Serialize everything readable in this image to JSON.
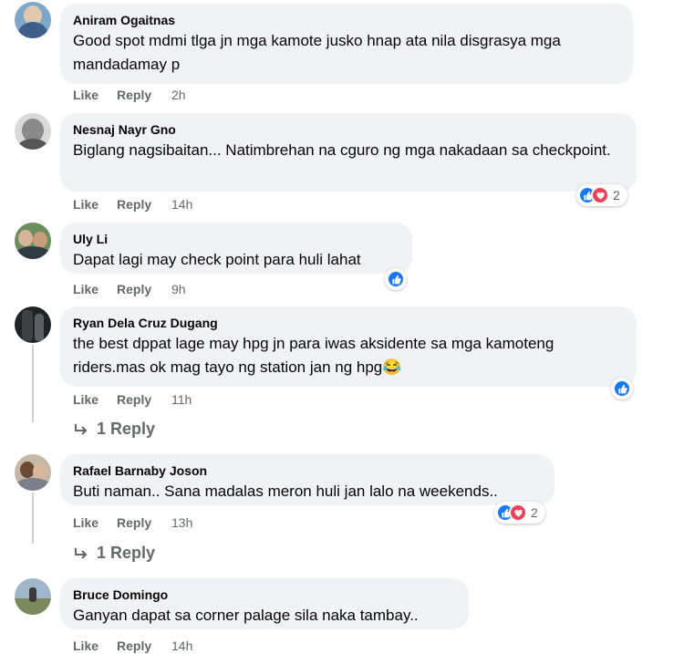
{
  "comments": [
    {
      "author": "Aniram Ogaitnas",
      "text": "Good spot mdmi tlga jn mga kamote jusko hnap ata nila disgrasya mga mandadamay p",
      "like": "Like",
      "reply": "Reply",
      "time": "2h"
    },
    {
      "author": "Nesnaj Nayr Gno",
      "text": "Biglang nagsibaitan... Natimbrehan na cguro ng mga nakadaan sa checkpoint.",
      "like": "Like",
      "reply": "Reply",
      "time": "14h",
      "reactions": "2"
    },
    {
      "author": "Uly Li",
      "text": "Dapat lagi may check point para huli lahat",
      "like": "Like",
      "reply": "Reply",
      "time": "9h"
    },
    {
      "author": "Ryan Dela Cruz Dugang",
      "text": "the best dppat lage may hpg jn para iwas aksidente sa mga kamoteng riders.mas ok mag tayo ng station jan ng hpg😂",
      "like": "Like",
      "reply": "Reply",
      "time": "11h",
      "replies": "1 Reply"
    },
    {
      "author": "Rafael Barnaby Joson",
      "text": "Buti naman.. Sana madalas meron huli jan lalo na weekends..",
      "like": "Like",
      "reply": "Reply",
      "time": "13h",
      "reactions": "2",
      "replies": "1 Reply"
    },
    {
      "author": "Bruce Domingo",
      "text": "Ganyan dapat sa corner palage sila naka tambay..",
      "like": "Like",
      "reply": "Reply",
      "time": "14h"
    }
  ],
  "colors": {
    "bubble": "#f0f2f5",
    "like_blue": "#1877f2",
    "love_red": "#f33e58",
    "secondary_text": "#65676b"
  }
}
